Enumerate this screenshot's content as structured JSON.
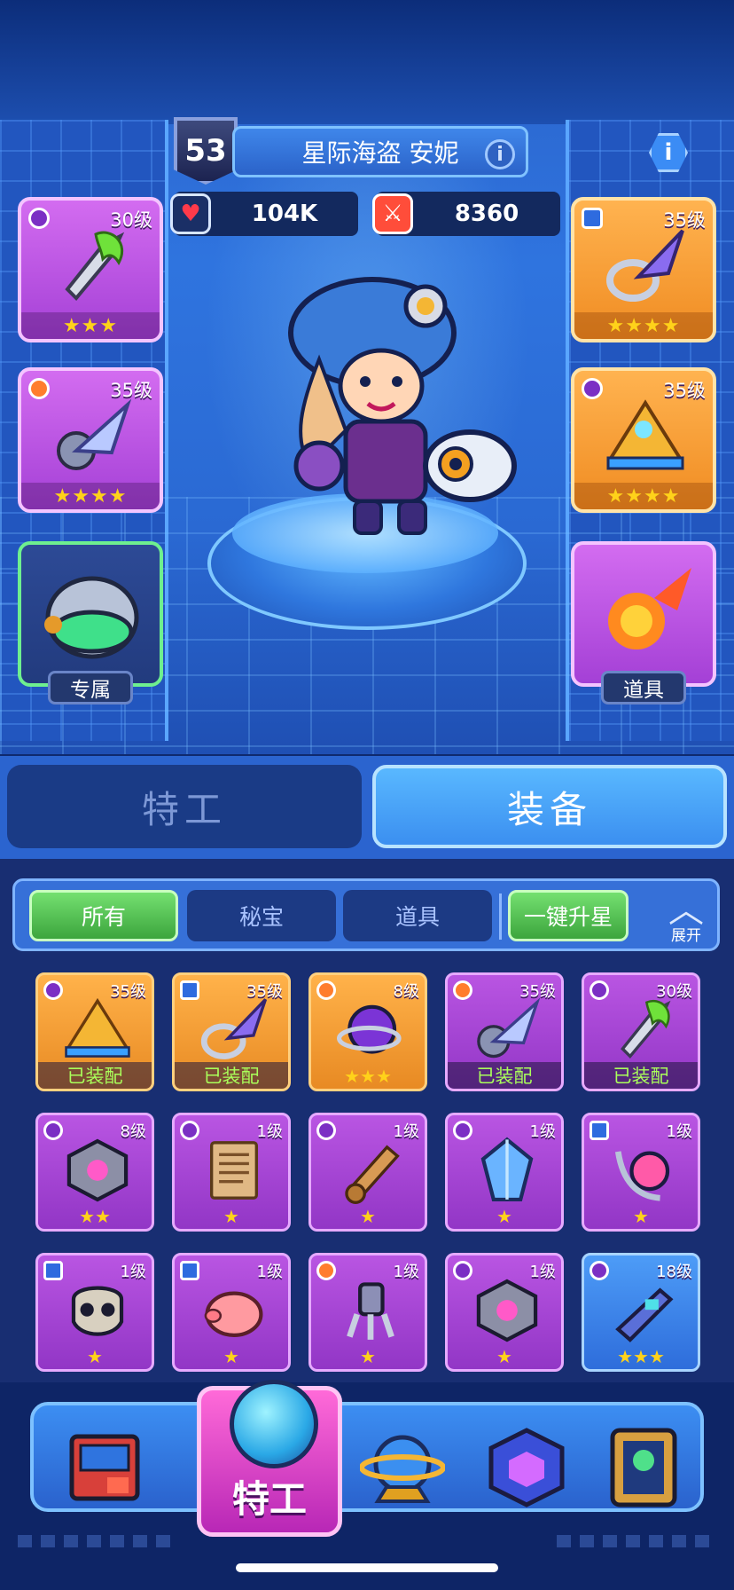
{
  "hero": {
    "level": "53",
    "name": "星际海盗 安妮",
    "hp": "104K",
    "attack": "8360",
    "info_icon": "info-icon"
  },
  "equipped_slots": {
    "left": [
      {
        "level": "30级",
        "stars": "★★★",
        "badge": "gem",
        "icon": "green-flame-sword-icon"
      },
      {
        "level": "35级",
        "stars": "★★★★",
        "badge": "crown",
        "icon": "lightning-crystal-gauntlet-icon"
      },
      {
        "label": "专属",
        "icon": "goggles-helmet-icon"
      }
    ],
    "right": [
      {
        "level": "35级",
        "stars": "★★★★",
        "badge": "shield",
        "icon": "crystal-ring-icon"
      },
      {
        "level": "35级",
        "stars": "★★★★",
        "badge": "gem",
        "icon": "golden-pyramid-icon"
      },
      {
        "label": "道具",
        "icon": "fireball-icon"
      }
    ]
  },
  "tabs": {
    "agent": "特工",
    "equipment": "装备"
  },
  "filters": {
    "all": "所有",
    "treasure": "秘宝",
    "items": "道具",
    "upgrade_all": "一键升星",
    "expand": "展开"
  },
  "inventory": [
    {
      "level": "35级",
      "status": "已装配",
      "badge": "gem",
      "icon": "golden-pyramid-icon",
      "color": "gold"
    },
    {
      "level": "35级",
      "status": "已装配",
      "badge": "shield",
      "icon": "crystal-ring-icon",
      "color": "gold"
    },
    {
      "level": "8级",
      "stars": "★★★",
      "badge": "crown",
      "icon": "purple-orb-icon",
      "color": "gold"
    },
    {
      "level": "35级",
      "status": "已装配",
      "badge": "crown",
      "icon": "lightning-crystal-gauntlet-icon",
      "color": "violet"
    },
    {
      "level": "30级",
      "status": "已装配",
      "badge": "gem",
      "icon": "green-flame-sword-icon",
      "color": "violet"
    },
    {
      "level": "8级",
      "stars": "★★",
      "badge": "gem",
      "icon": "hex-core-icon",
      "color": "violet"
    },
    {
      "level": "1级",
      "stars": "★",
      "badge": "gem",
      "icon": "ancient-scroll-icon",
      "color": "violet"
    },
    {
      "level": "1级",
      "stars": "★",
      "badge": "gem",
      "icon": "rolled-parchment-icon",
      "color": "violet"
    },
    {
      "level": "1级",
      "stars": "★",
      "badge": "gem",
      "icon": "blue-crystal-icon",
      "color": "violet"
    },
    {
      "level": "1级",
      "stars": "★",
      "badge": "shield",
      "icon": "orb-claw-icon",
      "color": "violet"
    },
    {
      "level": "1级",
      "stars": "★",
      "badge": "shield",
      "icon": "gas-mask-icon",
      "color": "violet"
    },
    {
      "level": "1级",
      "stars": "★",
      "badge": "shield",
      "icon": "piggy-bank-icon",
      "color": "violet"
    },
    {
      "level": "1级",
      "stars": "★",
      "badge": "crown",
      "icon": "robot-claw-icon",
      "color": "violet"
    },
    {
      "level": "1级",
      "stars": "★",
      "badge": "gem",
      "icon": "hex-core-icon",
      "color": "violet"
    },
    {
      "level": "18级",
      "stars": "★★★",
      "badge": "gem",
      "icon": "blaster-gun-icon",
      "color": "blue"
    }
  ],
  "bottom_nav": {
    "active_label": "特工",
    "items": [
      "shop-console-icon",
      "agent-helmet-icon",
      "planet-icon",
      "cube-icon",
      "portal-icon"
    ]
  }
}
